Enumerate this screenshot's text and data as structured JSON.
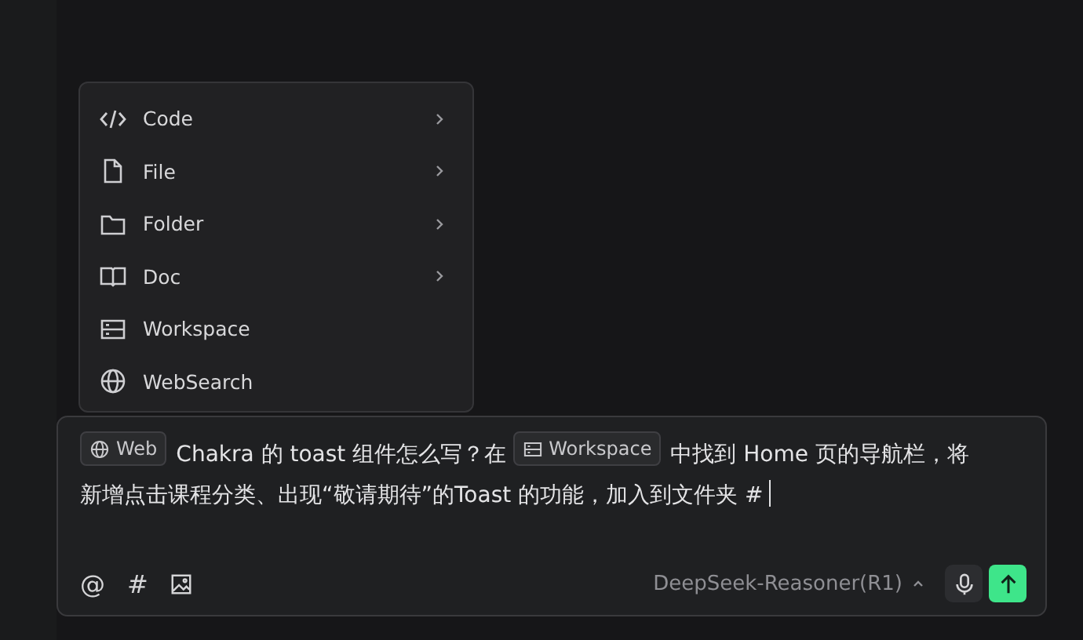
{
  "menu": {
    "items": [
      {
        "label": "Code",
        "has_submenu": true
      },
      {
        "label": "File",
        "has_submenu": true
      },
      {
        "label": "Folder",
        "has_submenu": true
      },
      {
        "label": "Doc",
        "has_submenu": true
      },
      {
        "label": "Workspace",
        "has_submenu": false
      },
      {
        "label": "WebSearch",
        "has_submenu": false
      }
    ]
  },
  "composer": {
    "message": [
      {
        "kind": "web-chip",
        "text": "Web"
      },
      {
        "kind": "text",
        "text": "Chakra 的 toast 组件怎么写？在"
      },
      {
        "kind": "workspace-chip",
        "text": "Workspace"
      },
      {
        "kind": "text",
        "text": "中找到 Home 页的导航栏，将新增点击课程分类、出现“敬请期待”的Toast 的功能，加入到文件夹 #"
      }
    ],
    "tools": [
      "@",
      "#"
    ],
    "model": "DeepSeek-Reasoner(R1)"
  }
}
